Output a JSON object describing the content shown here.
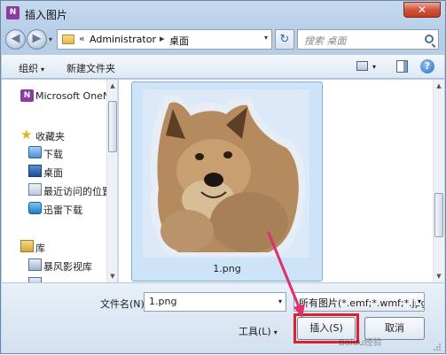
{
  "window": {
    "title": "插入图片",
    "app_icon": "N",
    "close_glyph": "✕"
  },
  "nav": {
    "back_glyph": "◀",
    "forward_glyph": "▶",
    "breadcrumb": [
      "Administrator",
      "桌面"
    ],
    "crumb_sep": "«",
    "crumb_arrow": "▸",
    "search_placeholder": "搜索 桌面"
  },
  "toolbar": {
    "organize": "组织",
    "new_folder": "新建文件夹"
  },
  "sidebar": {
    "items": [
      {
        "label": "Microsoft OneNo",
        "icon": "onenote-icon"
      },
      {
        "label": "收藏夹",
        "icon": "star-icon"
      },
      {
        "label": "下载",
        "icon": "download-icon"
      },
      {
        "label": "桌面",
        "icon": "desktop-icon"
      },
      {
        "label": "最近访问的位置",
        "icon": "recent-icon"
      },
      {
        "label": "迅雷下载",
        "icon": "xunlei-icon"
      },
      {
        "label": "库",
        "icon": "library-icon"
      },
      {
        "label": "暴风影视库",
        "icon": "video-library-icon"
      }
    ]
  },
  "content": {
    "file_name": "1.png"
  },
  "footer": {
    "file_name_label": "文件名(N):",
    "file_name_value": "1.png",
    "file_type": "所有图片(*.emf;*.wmf;*.jpg;*.jp",
    "tools": "工具(L)",
    "insert": "插入(S)",
    "cancel": "取消"
  },
  "watermark": "Baidu经验",
  "colors": {
    "highlight": "#e0202a",
    "arrow": "#e0306a",
    "selection": "#cde3f8"
  }
}
